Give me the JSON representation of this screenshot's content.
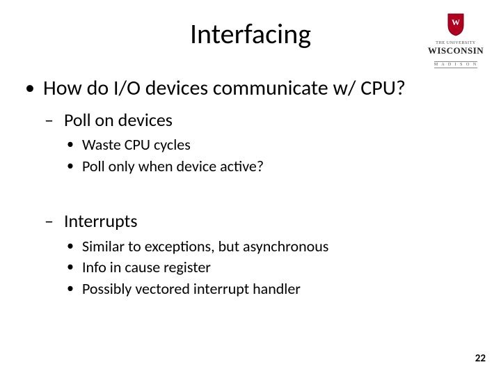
{
  "title": "Interfacing",
  "logo": {
    "topline": "THE UNIVERSITY",
    "main": "WISCONSIN",
    "sub": "M A D I S O N"
  },
  "bullets": {
    "q": "How do I/O devices communicate w/ CPU?",
    "poll": {
      "label": "Poll on devices",
      "sub": [
        "Waste CPU cycles",
        "Poll only when device active?"
      ]
    },
    "intr": {
      "label": "Interrupts",
      "sub": [
        "Similar to exceptions, but asynchronous",
        "Info in cause register",
        "Possibly vectored interrupt handler"
      ]
    }
  },
  "page": "22"
}
